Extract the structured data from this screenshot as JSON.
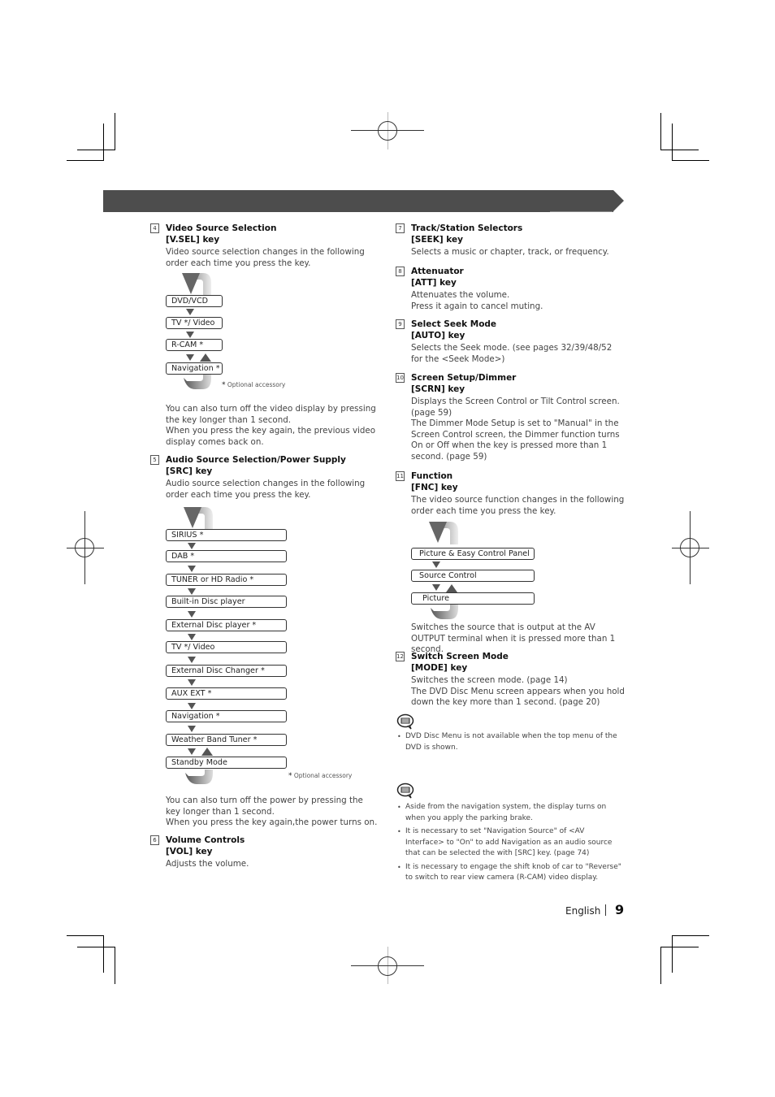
{
  "sections": {
    "s4": {
      "number": "4",
      "title": "Video Source Selection",
      "key": "[V.SEL] key",
      "intro": "Video source selection changes in the following order each time you press the key.",
      "flow": [
        "DVD/VCD",
        "TV */ Video",
        "R-CAM *",
        "Navigation *"
      ],
      "optional_mark": "*",
      "optional_note": "Optional accessory",
      "after_1": "You can also turn off the video display by pressing the key longer than 1 second.",
      "after_2": "When you press the key again, the previous video display comes back on."
    },
    "s5": {
      "number": "5",
      "title": "Audio Source Selection/Power Supply",
      "key": "[SRC] key",
      "intro": "Audio source selection changes in the following order each time you press the key.",
      "flow": [
        "SIRIUS *",
        "DAB *",
        "TUNER or HD Radio *",
        "Built-in Disc player",
        "External Disc player *",
        "TV */ Video",
        "External Disc Changer *",
        "AUX EXT *",
        "Navigation *",
        "Weather Band Tuner *",
        "Standby Mode"
      ],
      "optional_mark": "*",
      "optional_note": "Optional accessory",
      "after_1": "You can also turn off the power by pressing the key longer than 1 second.",
      "after_2": "When you press the key again,the power turns on."
    },
    "s6": {
      "number": "6",
      "title": "Volume Controls",
      "key": "[VOL] key",
      "body": "Adjusts the volume."
    },
    "s7": {
      "number": "7",
      "title": "Track/Station Selectors",
      "key": "[SEEK] key",
      "body": "Selects a music or chapter, track, or frequency."
    },
    "s8": {
      "number": "8",
      "title": "Attenuator",
      "key": "[ATT] key",
      "body_1": "Attenuates the volume.",
      "body_2": "Press it again to cancel muting."
    },
    "s9": {
      "number": "9",
      "title": "Select Seek Mode",
      "key": "[AUTO] key",
      "body": "Selects the Seek mode. (see pages 32/39/48/52 for the <Seek Mode>)"
    },
    "s10": {
      "number": "10",
      "title": "Screen Setup/Dimmer",
      "key": "[SCRN] key",
      "body_1": "Displays the Screen Control or Tilt Control screen. (page 59)",
      "body_2": "The Dimmer Mode Setup is set to  \"Manual\" in the Screen Control screen, the Dimmer function turns On or Off when the key is pressed more than 1 second. (page 59)"
    },
    "s11": {
      "number": "11",
      "title": "Function",
      "key": "[FNC] key",
      "intro": "The video source function changes in the following order each time you press the key.",
      "flow": [
        "Picture & Easy Control Panel",
        "Source Control",
        "Picture"
      ],
      "after": "Switches the source that is output at the AV OUTPUT terminal when it is pressed more than 1 second."
    },
    "s12": {
      "number": "12",
      "title": "Switch Screen Mode",
      "key": "[MODE] key",
      "body_1": "Switches the screen mode. (page 14)",
      "body_2": "The DVD Disc Menu screen appears when you hold down the key more than 1 second. (page 20)"
    }
  },
  "notes": {
    "note1": [
      "DVD Disc Menu is not available when the top menu of the DVD is shown."
    ],
    "note2": [
      "Aside from the navigation system, the display  turns on when you apply the parking brake.",
      "It is necessary to set \"Navigation Source\" of <AV Interface> to \"On\" to add Navigation as an audio source that can be selected the with [SRC] key. (page 74)",
      "It is necessary to engage the shift knob of car to \"Reverse\" to switch to rear view camera (R-CAM) video display."
    ]
  },
  "footer": {
    "language": "English",
    "page": "9"
  }
}
